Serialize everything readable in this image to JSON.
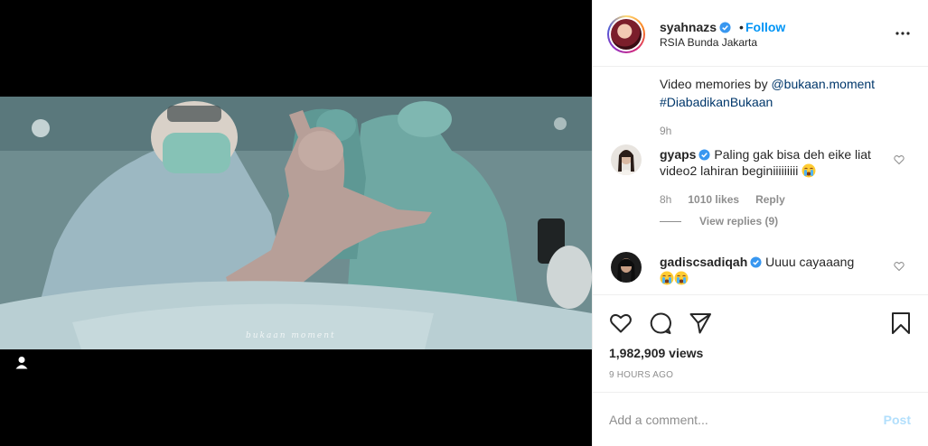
{
  "video": {
    "watermark": "bukaan moment"
  },
  "header": {
    "username": "syahnazs",
    "separator": "•",
    "follow_label": "Follow",
    "location": "RSIA Bunda Jakarta"
  },
  "caption": {
    "prefix": "Video memories by ",
    "mention": "@bukaan.moment",
    "hashtag": "#DiabadikanBukaan",
    "time": "9h"
  },
  "comments": [
    {
      "username": "gyaps",
      "text": "Paling gak bisa deh eike liat video2 lahiran beginiiiiiiiii",
      "time": "8h",
      "likes": "1010 likes",
      "reply_label": "Reply",
      "view_replies": "View replies (9)"
    },
    {
      "username": "gadiscsadiqah",
      "text": "Uuuu cayaaang"
    }
  ],
  "stats": {
    "views": "1,982,909 views",
    "posted": "9 HOURS AGO"
  },
  "composer": {
    "placeholder": "Add a comment...",
    "post_label": "Post"
  },
  "colors": {
    "accent": "#0095f6",
    "link": "#00376b",
    "muted": "#8e8e8e",
    "post_disabled": "#b2dffc"
  }
}
